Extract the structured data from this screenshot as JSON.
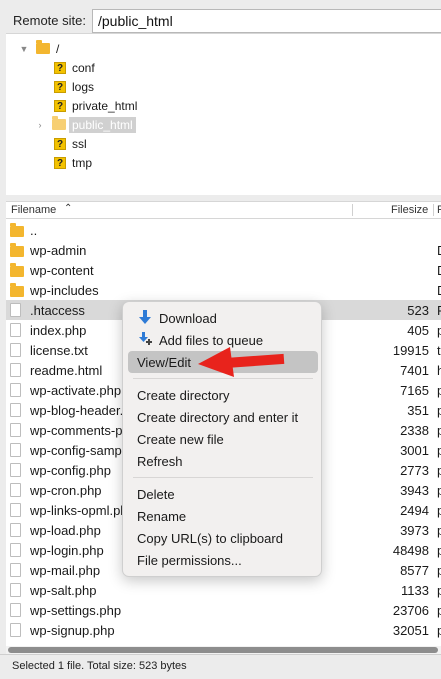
{
  "remote_site": {
    "label": "Remote site:",
    "path": "/public_html"
  },
  "tree": {
    "root": "/",
    "items": [
      "conf",
      "logs",
      "private_html",
      "public_html",
      "ssl",
      "tmp"
    ],
    "selected": "public_html"
  },
  "list": {
    "columns": {
      "filename": "Filename",
      "filesize": "Filesize",
      "filetype": "F"
    },
    "rows": [
      {
        "name": "..",
        "size": "",
        "type": "",
        "kind": "folder"
      },
      {
        "name": "wp-admin",
        "size": "",
        "type": "D",
        "kind": "folder"
      },
      {
        "name": "wp-content",
        "size": "",
        "type": "D",
        "kind": "folder"
      },
      {
        "name": "wp-includes",
        "size": "",
        "type": "D",
        "kind": "folder"
      },
      {
        "name": ".htaccess",
        "size": "523",
        "type": "F",
        "kind": "file"
      },
      {
        "name": "index.php",
        "size": "405",
        "type": "p",
        "kind": "file"
      },
      {
        "name": "license.txt",
        "size": "19915",
        "type": "t",
        "kind": "file"
      },
      {
        "name": "readme.html",
        "size": "7401",
        "type": "h",
        "kind": "file"
      },
      {
        "name": "wp-activate.php",
        "size": "7165",
        "type": "p",
        "kind": "file"
      },
      {
        "name": "wp-blog-header.php",
        "size": "351",
        "type": "p",
        "kind": "file"
      },
      {
        "name": "wp-comments-post.php",
        "size": "2338",
        "type": "p",
        "kind": "file"
      },
      {
        "name": "wp-config-sample.php",
        "size": "3001",
        "type": "p",
        "kind": "file"
      },
      {
        "name": "wp-config.php",
        "size": "2773",
        "type": "p",
        "kind": "file"
      },
      {
        "name": "wp-cron.php",
        "size": "3943",
        "type": "p",
        "kind": "file"
      },
      {
        "name": "wp-links-opml.php",
        "size": "2494",
        "type": "p",
        "kind": "file"
      },
      {
        "name": "wp-load.php",
        "size": "3973",
        "type": "p",
        "kind": "file"
      },
      {
        "name": "wp-login.php",
        "size": "48498",
        "type": "p",
        "kind": "file"
      },
      {
        "name": "wp-mail.php",
        "size": "8577",
        "type": "p",
        "kind": "file"
      },
      {
        "name": "wp-salt.php",
        "size": "1133",
        "type": "p",
        "kind": "file"
      },
      {
        "name": "wp-settings.php",
        "size": "23706",
        "type": "p",
        "kind": "file"
      },
      {
        "name": "wp-signup.php",
        "size": "32051",
        "type": "p",
        "kind": "file"
      }
    ],
    "selected_index": 4
  },
  "context_menu": {
    "download": "Download",
    "add_to_queue": "Add files to queue",
    "view_edit": "View/Edit",
    "create_directory": "Create directory",
    "create_directory_enter": "Create directory and enter it",
    "create_new_file": "Create new file",
    "refresh": "Refresh",
    "delete": "Delete",
    "rename": "Rename",
    "copy_urls": "Copy URL(s) to clipboard",
    "file_permissions": "File permissions...",
    "highlighted": "View/Edit"
  },
  "status": {
    "text": "Selected 1 file. Total size: 523 bytes"
  },
  "colors": {
    "folder": "#f3b62f",
    "selection": "#d9d9d9",
    "menu_highlight": "#c4c4c4",
    "annotation_arrow": "#e8231c",
    "download_icon": "#2e7bd6"
  },
  "icons": {
    "folder": "folder-icon",
    "unknown": "unknown-file-icon",
    "document": "document-icon",
    "download": "download-arrow-icon",
    "queue": "add-to-queue-icon",
    "sort": "sort-ascending-icon",
    "annotation": "red-arrow-annotation"
  }
}
